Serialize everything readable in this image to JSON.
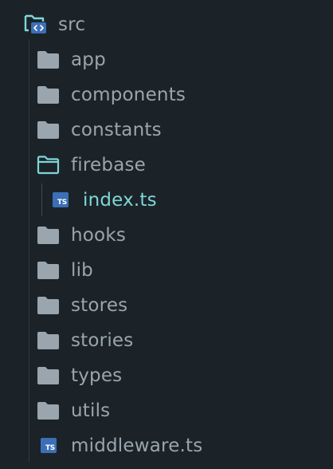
{
  "tree": {
    "root": {
      "label": "src",
      "icon": "folder-open-code-icon"
    },
    "items": [
      {
        "label": "app",
        "icon": "folder-icon"
      },
      {
        "label": "components",
        "icon": "folder-icon"
      },
      {
        "label": "constants",
        "icon": "folder-icon"
      },
      {
        "label": "firebase",
        "icon": "folder-open-icon"
      },
      {
        "label": "index.ts",
        "icon": "typescript-file-icon",
        "badge": "TS"
      },
      {
        "label": "hooks",
        "icon": "folder-icon"
      },
      {
        "label": "lib",
        "icon": "folder-icon"
      },
      {
        "label": "stores",
        "icon": "folder-icon"
      },
      {
        "label": "stories",
        "icon": "folder-icon"
      },
      {
        "label": "types",
        "icon": "folder-icon"
      },
      {
        "label": "utils",
        "icon": "folder-icon"
      },
      {
        "label": "middleware.ts",
        "icon": "typescript-file-icon",
        "badge": "TS"
      }
    ]
  },
  "colors": {
    "background": "#1b2329",
    "folder": "#9aa5ad",
    "text": "#9aa5ad",
    "active_text": "#7fd6d8",
    "open_folder_outline": "#7fd6d8",
    "typescript_badge": "#3b6fb8"
  }
}
